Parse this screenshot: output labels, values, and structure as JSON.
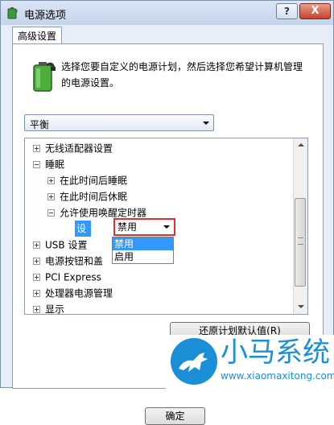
{
  "window": {
    "title": "电源选项",
    "help_label": "?",
    "close_label": "X"
  },
  "tab": {
    "label": "高级设置"
  },
  "description": "选择您要自定义的电源计划，然后选择您希望计算机管理的电源设置。",
  "plan_select": {
    "value": "平衡"
  },
  "tree": {
    "items": [
      {
        "label": "无线适配器设置",
        "expander": "plus"
      },
      {
        "label": "睡眠",
        "expander": "minus"
      },
      {
        "label": "在此时间后睡眠",
        "expander": "plus"
      },
      {
        "label": "在此时间后休眠",
        "expander": "plus"
      },
      {
        "label": "允许使用唤醒定时器",
        "expander": "minus"
      },
      {
        "label": "USB 设置",
        "expander": "plus"
      },
      {
        "label": "电源按钮和盖",
        "expander": "plus"
      },
      {
        "label": "PCI Express",
        "expander": "plus"
      },
      {
        "label": "处理器电源管理",
        "expander": "plus"
      },
      {
        "label": "显示",
        "expander": "plus"
      }
    ],
    "setting_label": "设置:",
    "setting_value": "禁用",
    "dropdown_options": [
      "禁用",
      "启用"
    ]
  },
  "buttons": {
    "restore": "还原计划默认值(R)",
    "ok": "确定"
  },
  "watermark": {
    "title": "小马系统",
    "url": "www.xiaomaxitong.com"
  },
  "colors": {
    "selection": "#3399ff",
    "highlight_border": "#d9332f",
    "watermark": "#1a8fd6"
  }
}
